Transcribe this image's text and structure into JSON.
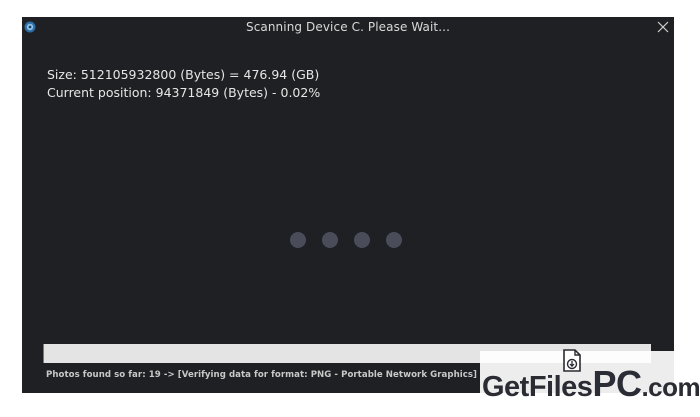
{
  "window": {
    "title": "Scanning Device C. Please Wait...",
    "icons": {
      "app": "app-logo-icon",
      "close": "close-icon"
    }
  },
  "scan": {
    "size_line": "Size: 512105932800 (Bytes) = 476.94 (GB)",
    "position_line": "Current position: 94371849 (Bytes) - 0.02%",
    "progress_fraction": 0.0002
  },
  "status": {
    "text": "Photos found so far: 19 -> [Verifying data for format: PNG - Portable Network Graphics]"
  },
  "watermark": {
    "text": "GetFilesPC.com",
    "part1": "GetFiles",
    "part2": "PC",
    "part3": ".com"
  },
  "colors": {
    "window_bg": "#1f2023",
    "spinner_dot": "#4a4d59",
    "progress_track": "#e4e4e4",
    "progress_fill": "#2a8be0"
  }
}
